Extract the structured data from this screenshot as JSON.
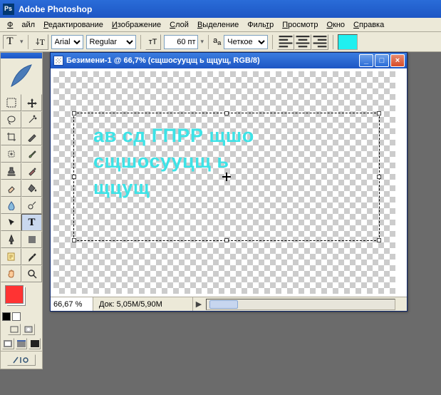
{
  "app": {
    "title": "Adobe Photoshop"
  },
  "menu": {
    "file": "Файл",
    "edit": "Редактирование",
    "image": "Изображение",
    "layer": "Слой",
    "select": "Выделение",
    "filter": "Фильтр",
    "view": "Просмотр",
    "window": "Окно",
    "help": "Справка"
  },
  "options": {
    "font_family": "Arial",
    "font_style": "Regular",
    "font_size": "60 пт",
    "aa": "Четкое",
    "color": "#20f0f0"
  },
  "doc": {
    "title": "Безимени-1 @ 66,7% (сщшосууцщ ь щцущ, RGB/8)",
    "zoom": "66,67 %",
    "info": "Док: 5,05M/5,90M",
    "text_line1": "ав сд ГПРР щшо",
    "text_line2": "сщшосууцщ ь",
    "text_line3": "щцущ"
  },
  "colors": {
    "foreground": "#ff3333"
  }
}
